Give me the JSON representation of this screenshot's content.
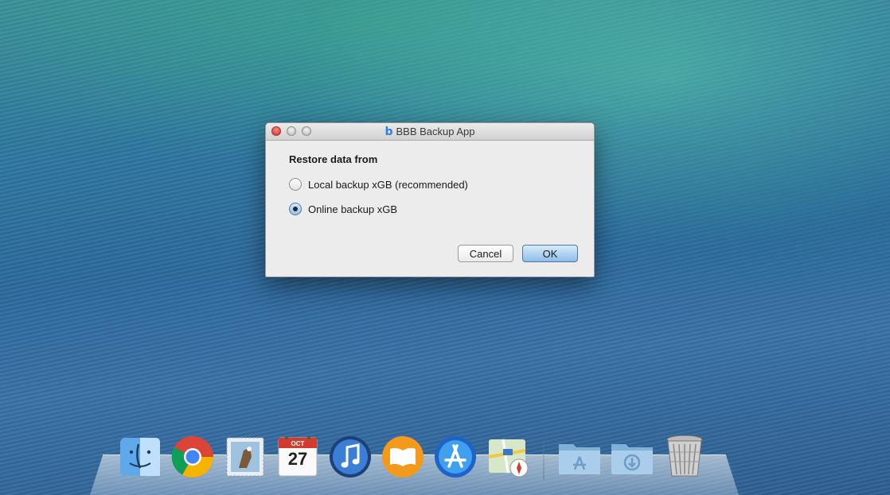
{
  "window": {
    "title": "BBB Backup App",
    "app_icon_glyph": "b",
    "prompt": "Restore data from",
    "options": [
      {
        "label": "Local backup xGB (recommended)",
        "selected": false
      },
      {
        "label": "Online backup xGB",
        "selected": true
      }
    ],
    "cancel_label": "Cancel",
    "ok_label": "OK"
  },
  "dock": {
    "calendar_month": "OCT",
    "calendar_day": "27",
    "items": [
      "finder-icon",
      "chrome-icon",
      "mail-icon",
      "calendar-icon",
      "itunes-icon",
      "ibooks-icon",
      "app-store-icon",
      "maps-icon",
      "applications-folder-icon",
      "downloads-folder-icon",
      "trash-icon"
    ]
  },
  "colors": {
    "close_button": "#e0443c",
    "ok_button": "#8ebde9",
    "app_icon": "#2f7fe0"
  }
}
